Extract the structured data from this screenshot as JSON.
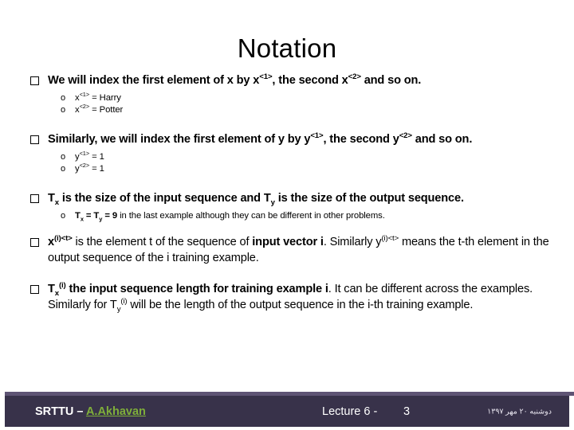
{
  "slide": {
    "title": "Notation",
    "bullets": [
      {
        "marker": "hollow-square",
        "text_html": "We will index the first element of x by x<sup>&lt;1&gt;</sup>, the second x<sup>&lt;2&gt;</sup> and so on.",
        "subs": [
          {
            "marker": "o",
            "text_html": "x<sup>&lt;1&gt;</sup> = Harry"
          },
          {
            "marker": "o",
            "text_html": "x<sup>&lt;2&gt;</sup> = Potter"
          }
        ]
      },
      {
        "marker": "hollow-square",
        "text_html": "Similarly, we will index the first element of y by y<sup>&lt;1&gt;</sup>, the second y<sup>&lt;2&gt;</sup> and so on.",
        "subs": [
          {
            "marker": "o",
            "text_html": "y<sup>&lt;1&gt;</sup> = 1"
          },
          {
            "marker": "o",
            "text_html": "y<sup>&lt;2&gt;</sup> = 1"
          }
        ]
      },
      {
        "marker": "hollow-square",
        "text_html": "T<sub>x</sub> is the size of the input sequence and T<sub>y</sub> is the size of the output sequence.",
        "subs": [
          {
            "marker": "o",
            "text_html": "<b>T<sub>x</sub> = T<sub>y</sub> = 9</b> in the last example although they can be different in other problems."
          }
        ]
      },
      {
        "marker": "hollow-square",
        "text_html": "<b>x<sup>(i)&lt;t&gt;</sup></b> <span class=\"normal\">is the element t of the sequence of</span> <b>input vector i</b><span class=\"normal\">. Similarly y<sup>(i)&lt;t&gt;</sup> means the t-th element in the output sequence of the i training example.</span>",
        "subs": []
      },
      {
        "marker": "hollow-square",
        "text_html": "<b>T<sub>x</sub><sup>(i)</sup> the input sequence length for training example i</b><span class=\"normal\">. It can be different across the examples. Similarly for T<sub>y</sub><sup>(i)</sup> will be the length of the output sequence in the i-th training example.</span>",
        "subs": []
      }
    ]
  },
  "footer": {
    "institution": "SRTTU",
    "separator": " – ",
    "author": "A.Akhavan",
    "lecture": "Lecture 6 -",
    "slide_number": "3",
    "date": "دوشنبه ۲۰ مهر ۱۳۹۷",
    "accent_color": "#5e5474",
    "bar_color": "#38324a",
    "link_color": "#7faf3a"
  }
}
